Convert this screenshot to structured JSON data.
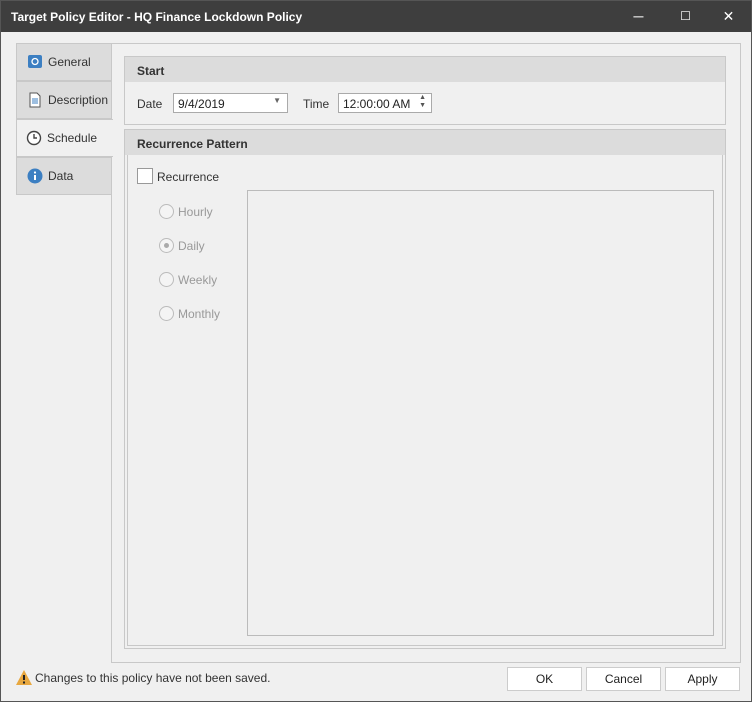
{
  "window": {
    "title": "Target Policy Editor - HQ Finance Lockdown Policy",
    "minimize": "─",
    "maximize": "☐",
    "close": "✕"
  },
  "tabs": [
    {
      "label": "General",
      "icon": "safe-icon"
    },
    {
      "label": "Description",
      "icon": "document-icon"
    },
    {
      "label": "Schedule",
      "icon": "clock-icon",
      "selected": true
    },
    {
      "label": "Data",
      "icon": "info-icon"
    }
  ],
  "start": {
    "header": "Start",
    "date_label": "Date",
    "date_value": "9/4/2019",
    "time_label": "Time",
    "time_value": "12:00:00 AM"
  },
  "recurrence": {
    "header": "Recurrence Pattern",
    "checkbox_label": "Recurrence",
    "checked": false,
    "options": [
      {
        "label": "Hourly",
        "selected": false
      },
      {
        "label": "Daily",
        "selected": true
      },
      {
        "label": "Weekly",
        "selected": false
      },
      {
        "label": "Monthly",
        "selected": false
      }
    ]
  },
  "footer": {
    "warning": "Changes to this policy have not been saved.",
    "ok": "OK",
    "cancel": "Cancel",
    "apply": "Apply"
  }
}
